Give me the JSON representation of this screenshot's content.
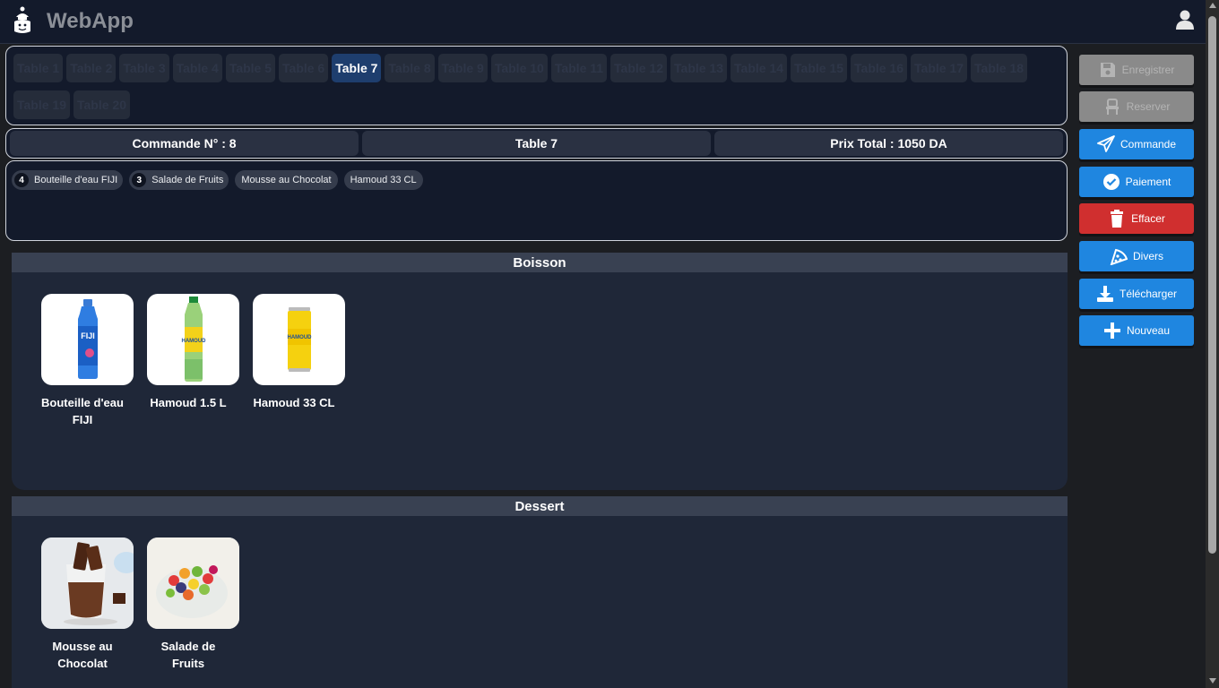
{
  "header": {
    "app_title": "WebApp",
    "logo_icon": "chef-logo-icon",
    "user_icon": "user-icon"
  },
  "tables": {
    "items": [
      "Table 1",
      "Table 2",
      "Table 3",
      "Table 4",
      "Table 5",
      "Table 6",
      "Table 7",
      "Table 8",
      "Table 9",
      "Table 10",
      "Table 11",
      "Table 12",
      "Table 13",
      "Table 14",
      "Table 15",
      "Table 16",
      "Table 17",
      "Table 18",
      "Table 19",
      "Table 20"
    ],
    "active": "Table 7"
  },
  "info": {
    "order_number": "Commande N° : 8",
    "table": "Table 7",
    "total": "Prix Total : 1050 DA"
  },
  "order_items": [
    {
      "qty": "4",
      "name": "Bouteille d'eau FIJI"
    },
    {
      "qty": "3",
      "name": "Salade de Fruits"
    },
    {
      "qty": "",
      "name": "Mousse au Chocolat"
    },
    {
      "qty": "",
      "name": "Hamoud 33 CL"
    }
  ],
  "categories": [
    {
      "name": "Boisson",
      "products": [
        {
          "name": "Bouteille d'eau FIJI",
          "image": "fiji-bottle-image"
        },
        {
          "name": "Hamoud 1.5 L",
          "image": "hamoud-bottle-image"
        },
        {
          "name": "Hamoud 33 CL",
          "image": "hamoud-can-image"
        }
      ]
    },
    {
      "name": "Dessert",
      "products": [
        {
          "name": "Mousse au Chocolat",
          "image": "chocolate-mousse-image"
        },
        {
          "name": "Salade de Fruits",
          "image": "fruit-salad-image"
        }
      ]
    }
  ],
  "actions": {
    "enregistrer": "Enregistrer",
    "reserver": "Reserver",
    "commande": "Commande",
    "paiement": "Paiement",
    "effacer": "Effacer",
    "divers": "Divers",
    "telecharger": "Télécharger",
    "nouveau": "Nouveau"
  },
  "colors": {
    "primary": "#1f86e0",
    "danger": "#d02f2f",
    "disabled": "#8a8a8a",
    "panel": "#131a2b",
    "active_table": "#1e3e6e"
  }
}
